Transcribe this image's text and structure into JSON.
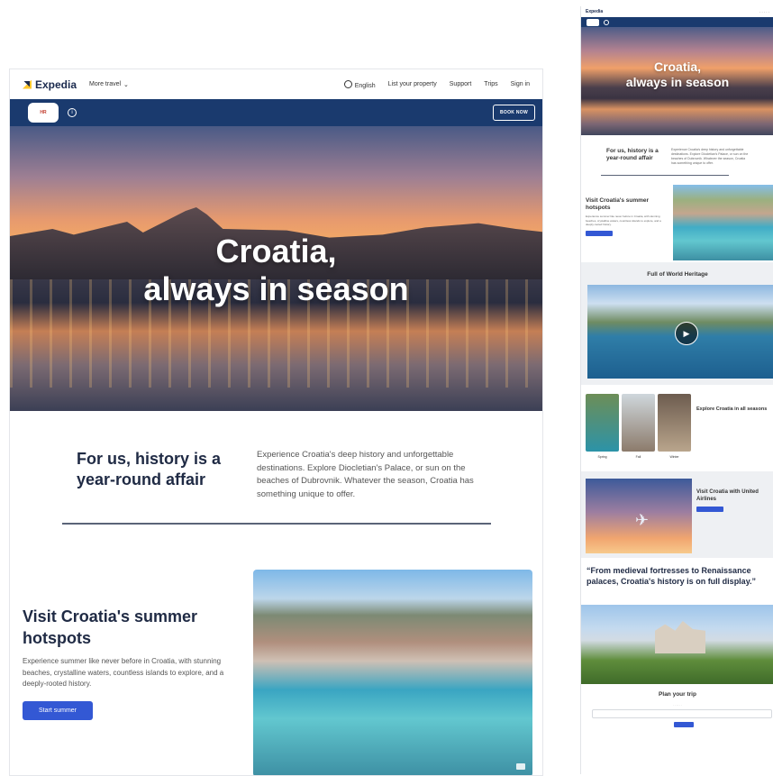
{
  "desktop": {
    "nav": {
      "logo": "Expedia",
      "more_travel": "More travel",
      "language": "English",
      "list_property": "List your property",
      "support": "Support",
      "trips": "Trips",
      "sign_in": "Sign in"
    },
    "banner": {
      "book_now": "BOOK NOW",
      "progress": 0.06
    },
    "hero": {
      "line1": "Croatia,",
      "line2": "always in season"
    },
    "history": {
      "title": "For us, history is a year-round affair",
      "body": "Experience Croatia's deep history and unforgettable destinations. Explore Diocletian's Palace, or sun on the beaches of Dubrovnik. Whatever the season, Croatia has something unique to offer."
    },
    "summer": {
      "title": "Visit Croatia's summer hotspots",
      "body": "Experience summer like never before in Croatia, with stunning beaches, crystalline waters, countless islands to explore, and a deeply-rooted history.",
      "button": "Start summer"
    }
  },
  "mobile": {
    "logo": "Expedia",
    "hero": {
      "line1": "Croatia,",
      "line2": "always in season"
    },
    "history_title": "For us, history is a year-round affair",
    "summer_title": "Visit Croatia's summer hotspots",
    "heritage_title": "Full of World Heritage",
    "seasons": {
      "title": "Explore Croatia in all seasons",
      "labels": [
        "Spring",
        "Fall",
        "Winter"
      ]
    },
    "united_title": "Visit Croatia with United Airlines",
    "quote": "“From medieval fortresses to Renaissance palaces, Croatia's history is on full display.”",
    "plan_title": "Plan your trip",
    "colors": {
      "navy": "#1a3a6e",
      "primary_button": "#3358d4",
      "progress": "#f2a33a"
    }
  }
}
